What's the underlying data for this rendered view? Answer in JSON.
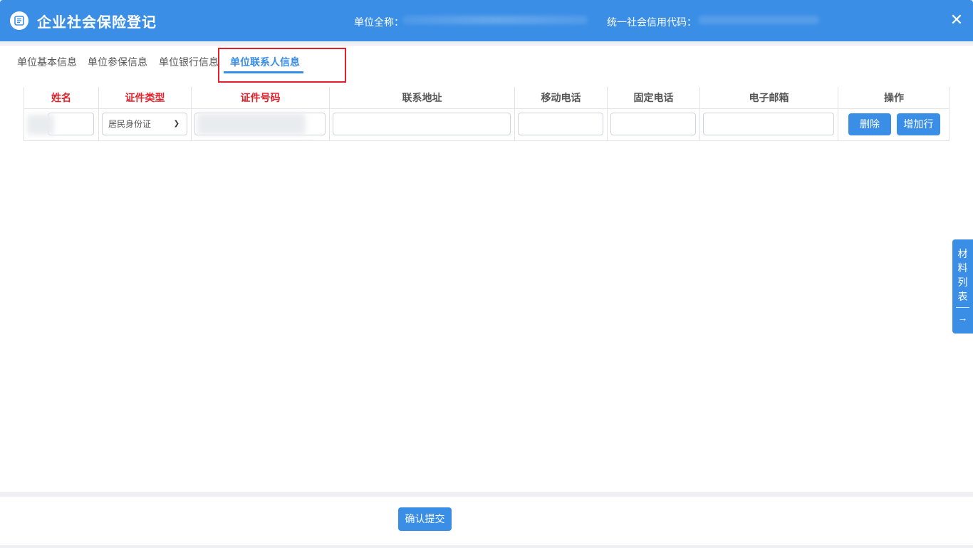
{
  "header": {
    "title": "企业社会保险登记",
    "unit_name_label": "单位全称：",
    "credit_code_label": "统一社会信用代码：",
    "close_icon": "close-icon"
  },
  "tabs": [
    {
      "label": "单位基本信息",
      "active": false
    },
    {
      "label": "单位参保信息",
      "active": false
    },
    {
      "label": "单位银行信息",
      "active": false
    },
    {
      "label": "单位联系人信息",
      "active": true
    }
  ],
  "table": {
    "columns": [
      {
        "label": "姓名",
        "required": true
      },
      {
        "label": "证件类型",
        "required": true
      },
      {
        "label": "证件号码",
        "required": true
      },
      {
        "label": "联系地址",
        "required": false
      },
      {
        "label": "移动电话",
        "required": false
      },
      {
        "label": "固定电话",
        "required": false
      },
      {
        "label": "电子邮箱",
        "required": false
      },
      {
        "label": "操作",
        "required": false
      }
    ],
    "row": {
      "name": "",
      "id_type": "居民身份证",
      "id_number": "",
      "address": "",
      "mobile": "",
      "phone": "",
      "email": ""
    },
    "actions": {
      "delete_label": "删除",
      "add_row_label": "增加行"
    }
  },
  "side_panel": {
    "label": "材料列表",
    "arrow": "→"
  },
  "footer": {
    "submit_label": "确认提交"
  },
  "colors": {
    "primary": "#3a8ee6",
    "required": "#e0202a",
    "highlight": "#e0202a"
  }
}
